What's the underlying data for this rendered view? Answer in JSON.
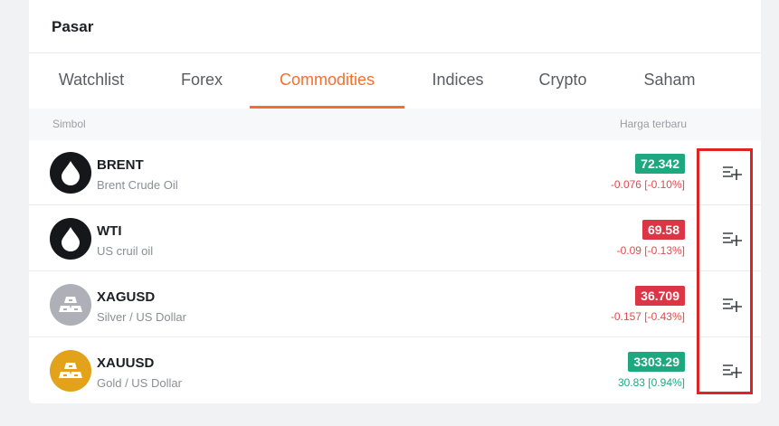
{
  "panel": {
    "title": "Pasar"
  },
  "tabs": [
    {
      "label": "Watchlist",
      "active": false
    },
    {
      "label": "Forex",
      "active": false
    },
    {
      "label": "Commodities",
      "active": true
    },
    {
      "label": "Indices",
      "active": false
    },
    {
      "label": "Crypto",
      "active": false
    },
    {
      "label": "Saham",
      "active": false
    }
  ],
  "columns": {
    "symbol": "Simbol",
    "price": "Harga terbaru"
  },
  "instruments": [
    {
      "symbol": "BRENT",
      "name": "Brent Crude Oil",
      "price": "72.342",
      "change": "-0.076 [-0.10%]",
      "trend": "down",
      "badge": "up",
      "icon": "oil-drop-icon"
    },
    {
      "symbol": "WTI",
      "name": "US cruil oil",
      "price": "69.58",
      "change": "-0.09 [-0.13%]",
      "trend": "down",
      "badge": "down",
      "icon": "oil-drop-icon"
    },
    {
      "symbol": "XAGUSD",
      "name": "Silver / US Dollar",
      "price": "36.709",
      "change": "-0.157 [-0.43%]",
      "trend": "down",
      "badge": "down",
      "icon": "silver-bars-icon"
    },
    {
      "symbol": "XAUUSD",
      "name": "Gold / US Dollar",
      "price": "3303.29",
      "change": "30.83 [0.94%]",
      "trend": "up",
      "badge": "up",
      "icon": "gold-bars-icon"
    }
  ],
  "colors": {
    "accent": "#f36f2e",
    "up": "#1ea87f",
    "down": "#dc3545",
    "highlight": "#e02424"
  }
}
